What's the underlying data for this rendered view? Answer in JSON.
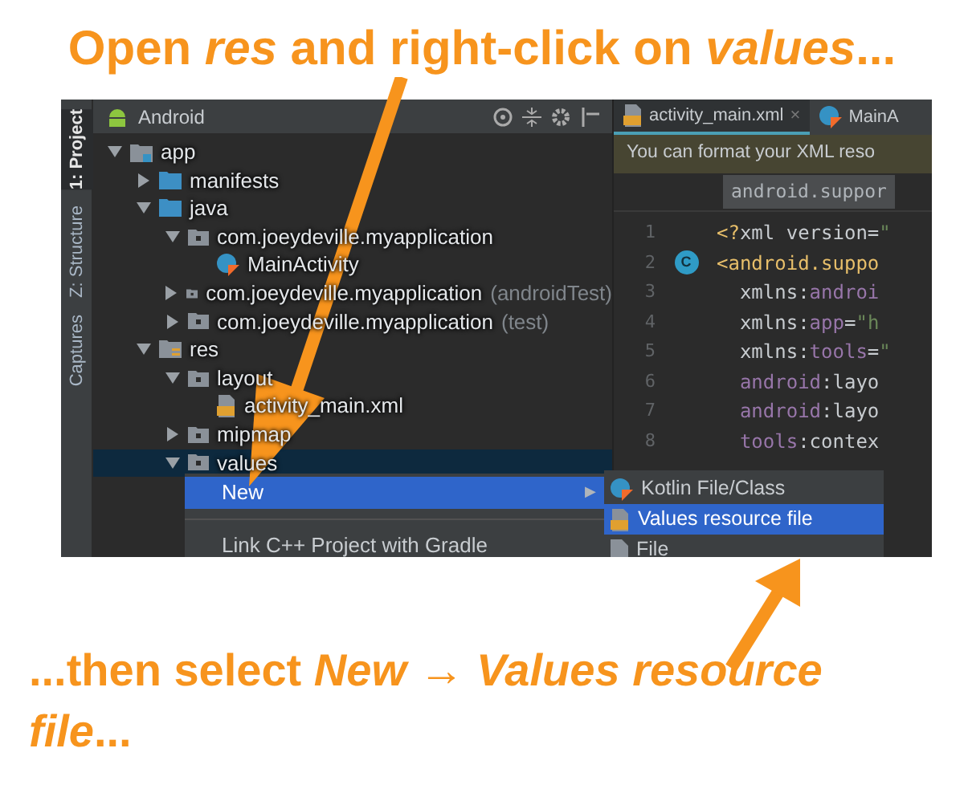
{
  "headline": "Open *res* and right-click on *values*...",
  "tool_strip": [
    {
      "label": "1: Project",
      "selected": true
    },
    {
      "label": "Z: Structure",
      "selected": false
    },
    {
      "label": "Captures",
      "selected": false
    }
  ],
  "project_panel": {
    "view": "Android",
    "tree": [
      {
        "label": "app",
        "kind": "module",
        "expanded": true,
        "selected": false,
        "children": [
          {
            "label": "manifests",
            "kind": "folder",
            "expanded": false,
            "selected": false
          },
          {
            "label": "java",
            "kind": "folder",
            "expanded": true,
            "selected": false,
            "children": [
              {
                "label": "com.joeydeville.myapplication",
                "kind": "package",
                "expanded": true,
                "selected": false,
                "children": [
                  {
                    "label": "MainActivity",
                    "kind": "kotlin-class",
                    "selected": false
                  }
                ]
              },
              {
                "label": "com.joeydeville.myapplication",
                "suffix": "(androidTest)",
                "kind": "package",
                "expanded": false,
                "selected": false
              },
              {
                "label": "com.joeydeville.myapplication",
                "suffix": "(test)",
                "kind": "package",
                "expanded": false,
                "selected": false
              }
            ]
          },
          {
            "label": "res",
            "kind": "res-folder",
            "expanded": true,
            "selected": false,
            "children": [
              {
                "label": "layout",
                "kind": "package",
                "expanded": true,
                "selected": false,
                "children": [
                  {
                    "label": "activity_main.xml",
                    "kind": "xml-file",
                    "selected": false
                  }
                ]
              },
              {
                "label": "mipmap",
                "kind": "package",
                "expanded": false,
                "selected": false
              },
              {
                "label": "values",
                "kind": "package",
                "expanded": true,
                "selected": true
              }
            ]
          }
        ]
      }
    ]
  },
  "editor": {
    "tabs": [
      {
        "label": "activity_main.xml",
        "kind": "xml-file",
        "selected": true,
        "close": "×"
      },
      {
        "label": "MainA",
        "kind": "kotlin-class",
        "selected": false
      }
    ],
    "notice": "You can format your XML reso",
    "breadcrumb": "android.suppor",
    "lines": [
      {
        "number": "1",
        "tokens": [
          {
            "kind": "tag",
            "text": "<?"
          },
          {
            "kind": "plain",
            "text": "xml version="
          },
          {
            "kind": "string",
            "text": "\""
          }
        ]
      },
      {
        "number": "2",
        "gutter": "C",
        "tokens": [
          {
            "kind": "tag",
            "text": "<android.suppo"
          }
        ]
      },
      {
        "number": "3",
        "tokens": [
          {
            "kind": "plain",
            "text": "  xmlns:"
          },
          {
            "kind": "ns",
            "text": "androi"
          }
        ]
      },
      {
        "number": "4",
        "tokens": [
          {
            "kind": "plain",
            "text": "  xmlns:"
          },
          {
            "kind": "ns",
            "text": "app"
          },
          {
            "kind": "plain",
            "text": "="
          },
          {
            "kind": "string",
            "text": "\"h"
          }
        ]
      },
      {
        "number": "5",
        "tokens": [
          {
            "kind": "plain",
            "text": "  xmlns:"
          },
          {
            "kind": "ns",
            "text": "tools"
          },
          {
            "kind": "plain",
            "text": "="
          },
          {
            "kind": "string",
            "text": "\""
          }
        ]
      },
      {
        "number": "6",
        "tokens": [
          {
            "kind": "ns",
            "text": "  android"
          },
          {
            "kind": "plain",
            "text": ":layo"
          }
        ]
      },
      {
        "number": "7",
        "tokens": [
          {
            "kind": "ns",
            "text": "  android"
          },
          {
            "kind": "plain",
            "text": ":layo"
          }
        ]
      },
      {
        "number": "8",
        "tokens": [
          {
            "kind": "ns",
            "text": "  tools"
          },
          {
            "kind": "plain",
            "text": ":contex"
          }
        ]
      }
    ]
  },
  "context_menu": {
    "items": [
      {
        "kind": "item",
        "label": "New",
        "submenu": "▶",
        "selected": true
      },
      {
        "kind": "separator"
      },
      {
        "kind": "item",
        "label": "Link C++ Project with Gradle",
        "selected": false
      }
    ]
  },
  "submenu": {
    "items": [
      {
        "label": "Kotlin File/Class",
        "kind": "kotlin-class",
        "selected": false
      },
      {
        "label": "Values resource file",
        "kind": "xml-file",
        "selected": true
      },
      {
        "label": "File",
        "kind": "file",
        "selected": false
      }
    ]
  },
  "footer": "...then select *New* → *Values resource file*..."
}
